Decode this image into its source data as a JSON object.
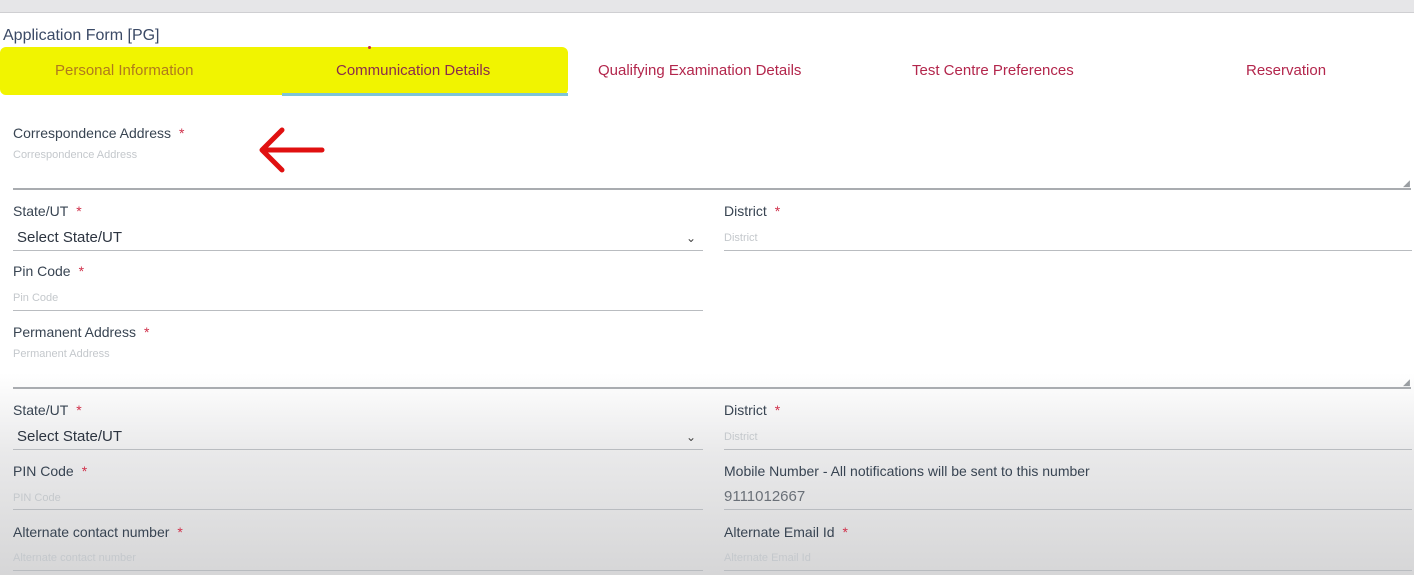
{
  "form": {
    "title": "Application Form [PG]"
  },
  "tabs": [
    {
      "label": "Personal Information"
    },
    {
      "label": "Communication Details"
    },
    {
      "label": "Qualifying Examination Details"
    },
    {
      "label": "Test Centre Preferences"
    },
    {
      "label": "Reservation"
    }
  ],
  "required_marker": "*",
  "correspondence": {
    "address_label": "Correspondence Address",
    "address_placeholder": "Correspondence Address",
    "state_label": "State/UT",
    "state_value": "Select State/UT",
    "district_label": "District",
    "district_placeholder": "District",
    "pin_label": "Pin Code",
    "pin_placeholder": "Pin Code"
  },
  "permanent": {
    "address_label": "Permanent Address",
    "address_placeholder": "Permanent Address",
    "state_label": "State/UT",
    "state_value": "Select State/UT",
    "district_label": "District",
    "district_placeholder": "District",
    "pin_label": "PIN Code",
    "pin_placeholder": "PIN Code"
  },
  "mobile": {
    "label": "Mobile Number - All notifications will be sent to this number",
    "value": "9111012667"
  },
  "alternate_contact": {
    "label": "Alternate contact number",
    "placeholder": "Alternate contact number"
  },
  "alternate_email": {
    "label": "Alternate Email Id",
    "placeholder": "Alternate Email Id"
  },
  "icons": {
    "dropdown": "chevron-down-icon",
    "annotation": "red-arrow-left-icon",
    "resize": "resize-handle-icon"
  },
  "colors": {
    "highlight": "#f1f400",
    "tab_text": "#b3264c",
    "required": "#d0304a",
    "arrow": "#e01010"
  }
}
